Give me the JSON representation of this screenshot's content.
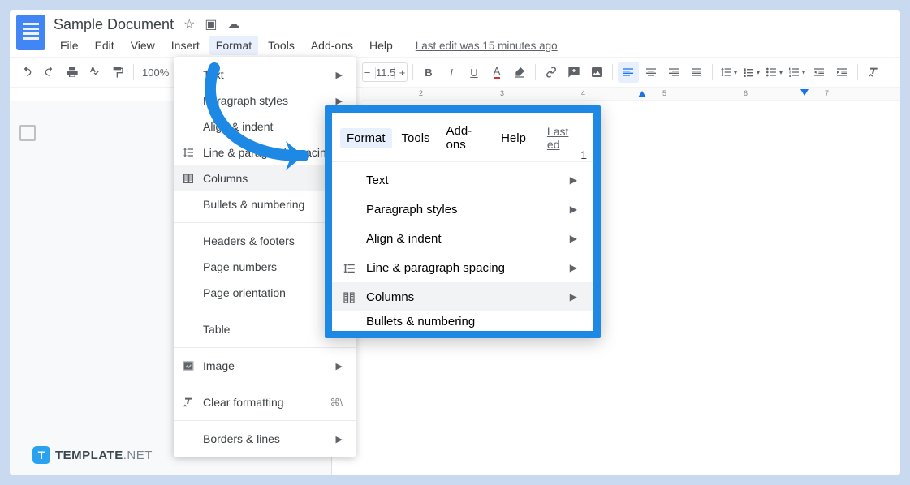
{
  "doc": {
    "title": "Sample Document"
  },
  "menubar": {
    "file": "File",
    "edit": "Edit",
    "view": "View",
    "insert": "Insert",
    "format": "Format",
    "tools": "Tools",
    "addons": "Add-ons",
    "help": "Help",
    "last_edit": "Last edit was 15 minutes ago"
  },
  "toolbar": {
    "zoom": "100%",
    "font_size": "11.5"
  },
  "ruler": {
    "ticks": [
      "2",
      "3",
      "4",
      "5",
      "6",
      "7"
    ]
  },
  "format_menu": {
    "text": "Text",
    "paragraph_styles": "Paragraph styles",
    "align_indent": "Align & indent",
    "line_spacing": "Line & paragraph spacing",
    "columns": "Columns",
    "bullets_numbering": "Bullets & numbering",
    "headers_footers": "Headers & footers",
    "page_numbers": "Page numbers",
    "page_orientation": "Page orientation",
    "table": "Table",
    "image": "Image",
    "clear_formatting": "Clear formatting",
    "clear_shortcut": "⌘\\",
    "borders_lines": "Borders & lines"
  },
  "callout": {
    "menubar": {
      "format": "Format",
      "tools": "Tools",
      "addons": "Add-ons",
      "help": "Help",
      "last": "Last ed"
    },
    "right_partial": "1",
    "text": "Text",
    "paragraph_styles": "Paragraph styles",
    "align_indent": "Align & indent",
    "line_spacing": "Line & paragraph spacing",
    "columns": "Columns",
    "bullets_numbering": "Bullets & numbering"
  },
  "footer": {
    "brand": "TEMPLATE",
    "suffix": ".NET",
    "badge": "T"
  }
}
